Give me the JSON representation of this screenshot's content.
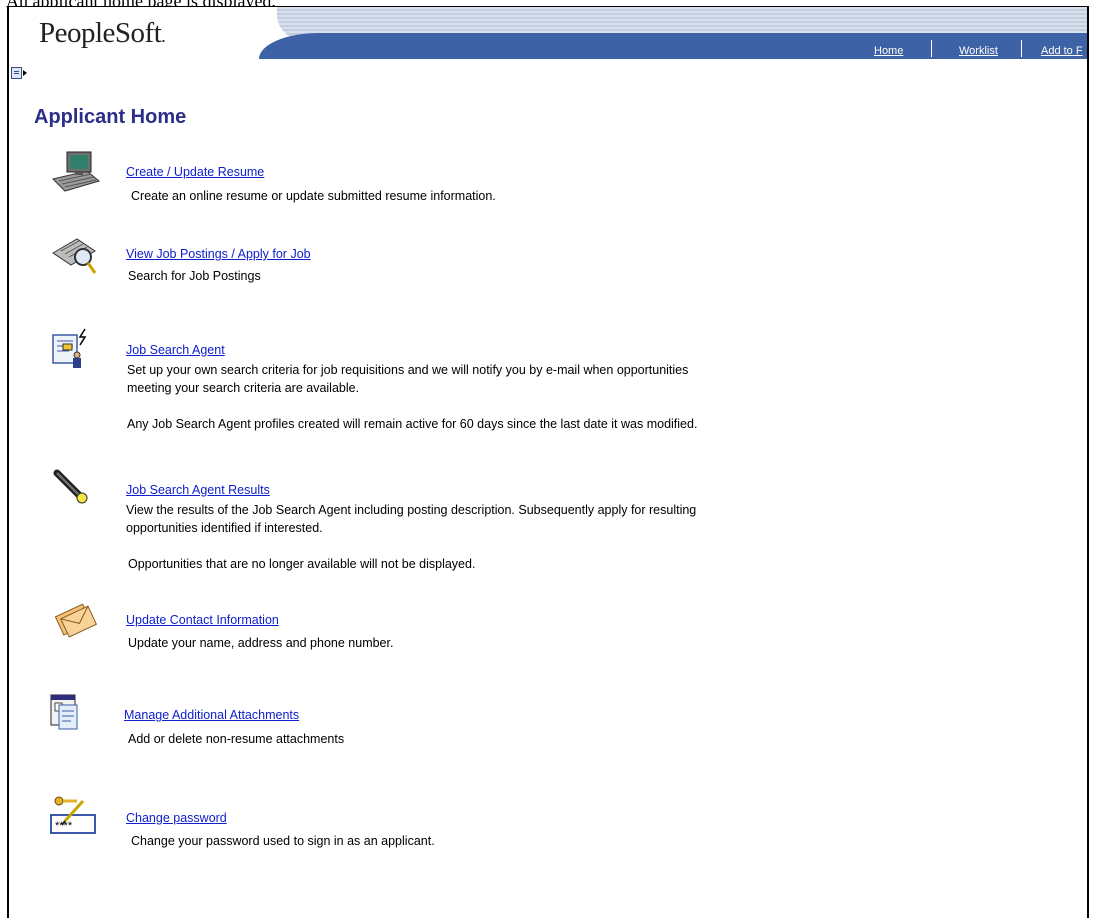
{
  "caption": "An applicant home page is displayed.",
  "header": {
    "logo": "PeopleSoft",
    "nav": [
      "Home",
      "Worklist",
      "Add to F"
    ]
  },
  "page": {
    "title": "Applicant Home"
  },
  "items": [
    {
      "icon": "resume-computer-icon",
      "link": "Create / Update Resume",
      "desc": [
        "Create an online resume or update submitted resume information."
      ]
    },
    {
      "icon": "magnifier-postings-icon",
      "link": "View Job Postings / Apply for Job",
      "desc": [
        "Search for Job Postings"
      ]
    },
    {
      "icon": "search-agent-icon",
      "link": "Job Search Agent",
      "desc": [
        "Set up your own search criteria for job requisitions and we will notify you by e-mail when opportunities meeting your search criteria are available.",
        "Any Job Search Agent profiles created will remain active for 60 days since the last date it was modified."
      ]
    },
    {
      "icon": "flashlight-icon",
      "link": "Job Search Agent Results",
      "desc": [
        "View the results of the Job Search Agent including posting description. Subsequently apply for resulting opportunities identified if interested.",
        "Opportunities that are no longer available will not be displayed."
      ]
    },
    {
      "icon": "envelopes-icon",
      "link": "Update Contact Information",
      "desc": [
        "Update your name, address and phone number."
      ]
    },
    {
      "icon": "attachments-icon",
      "link": "Manage Additional Attachments",
      "desc": [
        "Add or delete non-resume attachments"
      ]
    },
    {
      "icon": "key-password-icon",
      "link": "Change password",
      "desc": [
        "Change your password used to sign in as an applicant."
      ]
    }
  ],
  "colors": {
    "title": "#2c2e88",
    "link": "#1020cc",
    "navbar": "#3e62a6"
  }
}
